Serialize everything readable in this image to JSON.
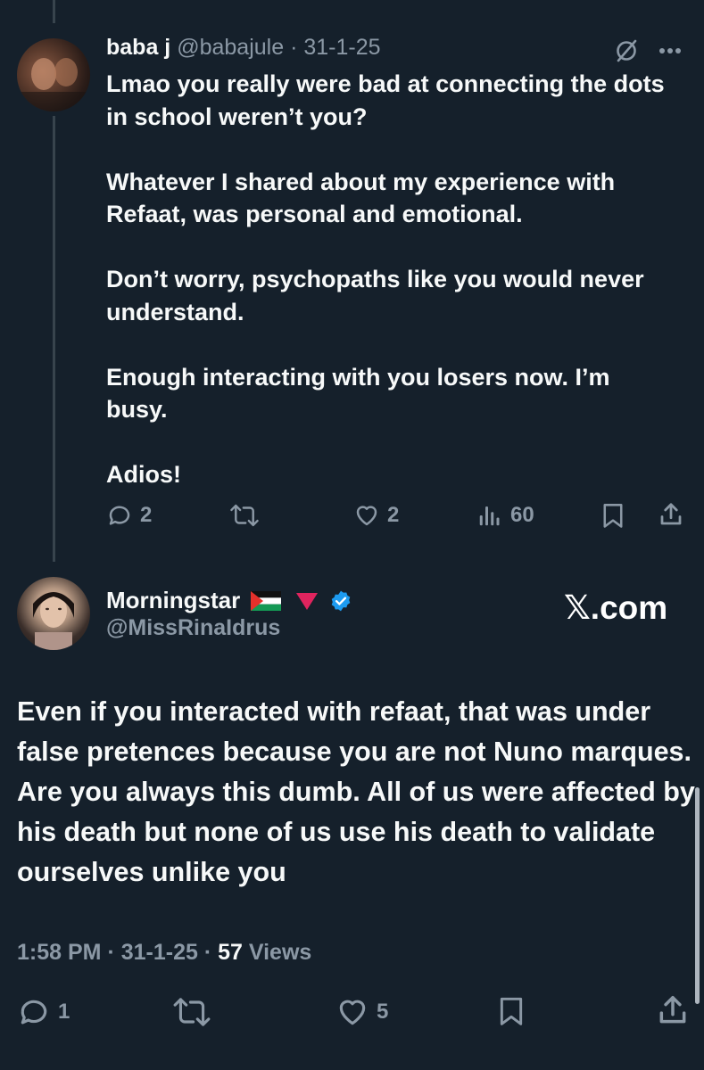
{
  "reply": {
    "display_name": "baba j",
    "handle": "@babajule",
    "separator": "·",
    "date": "31-1-25",
    "text": "Lmao you really were bad at connecting the dots in school weren’t you?\n\nWhatever I shared about my experience with Refaat, was personal and emotional.\n\nDon’t worry, psychopaths like you would never understand.\n\nEnough interacting with you losers now. I’m busy.\n\nAdios!",
    "replies": "2",
    "likes": "2",
    "views": "60",
    "icons": [
      "grok-icon",
      "more-icon",
      "reply-icon",
      "retweet-icon",
      "like-icon",
      "views-icon",
      "bookmark-icon",
      "share-icon"
    ]
  },
  "main": {
    "display_name": "Morningstar",
    "handle": "@MissRinaIdrus",
    "badges": [
      "palestine-flag-icon",
      "red-triangle-icon",
      "verified-badge-icon"
    ],
    "watermark": "𝕏.com",
    "text": "Even if you interacted with refaat, that was under false pretences because you are not Nuno marques. Are you always this dumb. All of us were affected by his death but none of us use his death to validate ourselves unlike you",
    "time": "1:58 PM",
    "separator": "·",
    "date": "31-1-25",
    "views_count": "57",
    "views_label": "Views",
    "replies": "1",
    "likes": "5"
  },
  "colors": {
    "background": "#15202b",
    "text": "#f7f9f9",
    "muted": "#8b98a5",
    "thread_line": "#38444d",
    "verified": "#1d9bf0",
    "red_triangle": "#e0245e"
  }
}
